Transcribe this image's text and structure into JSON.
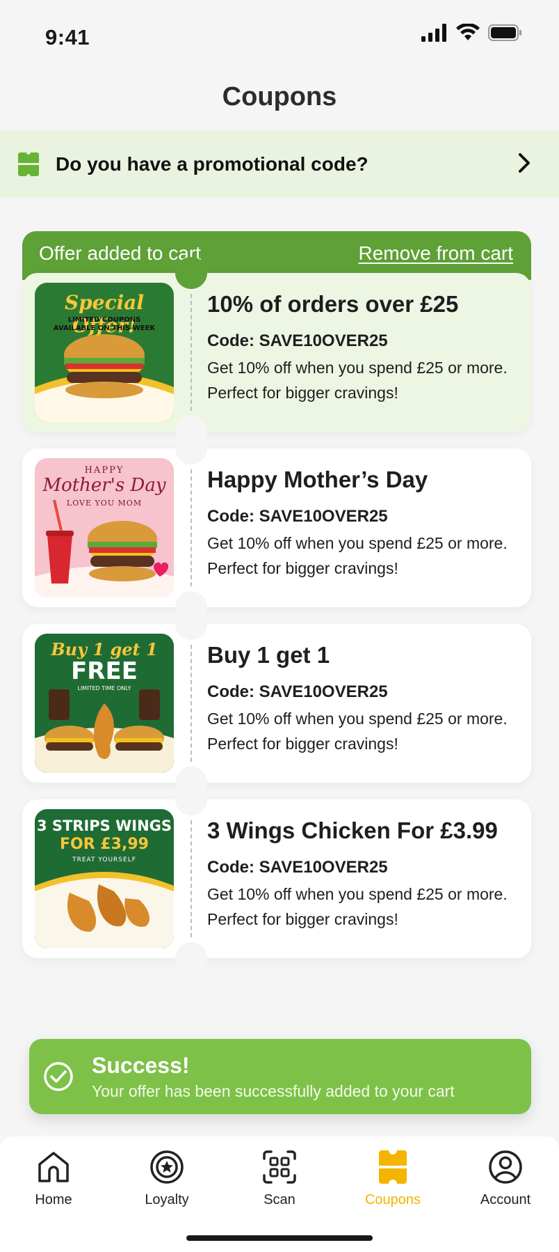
{
  "status_bar": {
    "time": "9:41"
  },
  "page": {
    "title": "Coupons"
  },
  "promo": {
    "label": "Do you have a promotional code?"
  },
  "offer_banner": {
    "label": "Offer added to cart",
    "remove_label": "Remove from cart"
  },
  "coupons": [
    {
      "title": "10% of orders over £25",
      "code": "Code: SAVE10OVER25",
      "description": "Get 10% off when you spend £25 or more. Perfect for bigger cravings!",
      "image_lines": [
        "Special Offer!",
        "LIMITED COUPONS",
        "AVAILABLE ON THIS WEEK"
      ]
    },
    {
      "title": "Happy Mother’s Day",
      "code": "Code: SAVE10OVER25",
      "description": "Get 10% off when you spend £25 or more. Perfect for bigger cravings!",
      "image_lines": [
        "HAPPY",
        "Mother's Day",
        "LOVE YOU MOM"
      ]
    },
    {
      "title": "Buy 1 get 1",
      "code": "Code: SAVE10OVER25",
      "description": "Get 10% off when you spend £25 or more. Perfect for bigger cravings!",
      "image_lines": [
        "Buy 1 get 1",
        "FREE",
        "LIMITED TIME ONLY"
      ]
    },
    {
      "title": "3 Wings Chicken For £3.99",
      "code": "Code: SAVE10OVER25",
      "description": "Get 10% off when you spend £25 or more. Perfect for bigger cravings!",
      "image_lines": [
        "3 STRIPS WINGS",
        "FOR £3,99",
        "TREAT YOURSELF"
      ]
    }
  ],
  "toast": {
    "title": "Success!",
    "message": "Your offer has been successfully added to your cart"
  },
  "tabs": [
    {
      "label": "Home",
      "icon": "home-icon"
    },
    {
      "label": "Loyalty",
      "icon": "loyalty-icon"
    },
    {
      "label": "Scan",
      "icon": "qr-scan-icon"
    },
    {
      "label": "Coupons",
      "icon": "coupon-icon",
      "active": true
    },
    {
      "label": "Account",
      "icon": "account-icon"
    }
  ],
  "colors": {
    "brand_green": "#5ea136",
    "light_green": "#edf6e3",
    "toast_green": "#7dc148",
    "active_tab": "#f4b400"
  }
}
